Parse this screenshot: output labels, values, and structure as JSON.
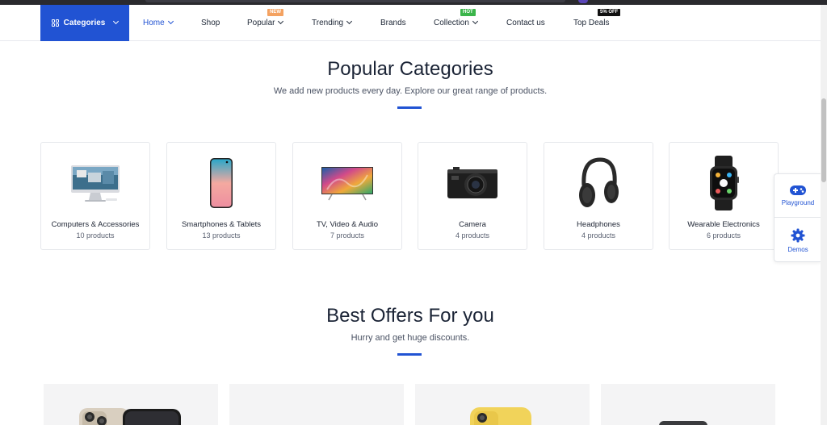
{
  "colors": {
    "accent": "#2153d3",
    "badge_new": "#f4a261",
    "badge_hot": "#3bb54a",
    "badge_off": "#111111"
  },
  "nav": {
    "categories_label": "Categories",
    "items": [
      {
        "label": "Home",
        "has_dropdown": true,
        "active": true
      },
      {
        "label": "Shop",
        "has_dropdown": false
      },
      {
        "label": "Popular",
        "has_dropdown": true,
        "badge": "NEW"
      },
      {
        "label": "Trending",
        "has_dropdown": true
      },
      {
        "label": "Brands",
        "has_dropdown": false
      },
      {
        "label": "Collection",
        "has_dropdown": true,
        "badge": "HOT"
      },
      {
        "label": "Contact us",
        "has_dropdown": false
      },
      {
        "label": "Top Deals",
        "has_dropdown": false,
        "badge": "5% OFF"
      }
    ]
  },
  "popular": {
    "title": "Popular Categories",
    "subtitle": "We add new products every day. Explore our great range of products.",
    "categories": [
      {
        "name": "Computers & Accessories",
        "count": "10 products",
        "icon": "desktop-computer-icon"
      },
      {
        "name": "Smartphones & Tablets",
        "count": "13 products",
        "icon": "smartphone-icon"
      },
      {
        "name": "TV, Video & Audio",
        "count": "7 products",
        "icon": "television-icon"
      },
      {
        "name": "Camera",
        "count": "4 products",
        "icon": "camera-icon"
      },
      {
        "name": "Headphones",
        "count": "4 products",
        "icon": "headphones-icon"
      },
      {
        "name": "Wearable Electronics",
        "count": "6 products",
        "icon": "smartwatch-icon"
      }
    ]
  },
  "side_widget": {
    "playground_label": "Playground",
    "demos_label": "Demos"
  },
  "offers": {
    "title": "Best Offers For you",
    "subtitle": "Hurry and get huge discounts."
  }
}
